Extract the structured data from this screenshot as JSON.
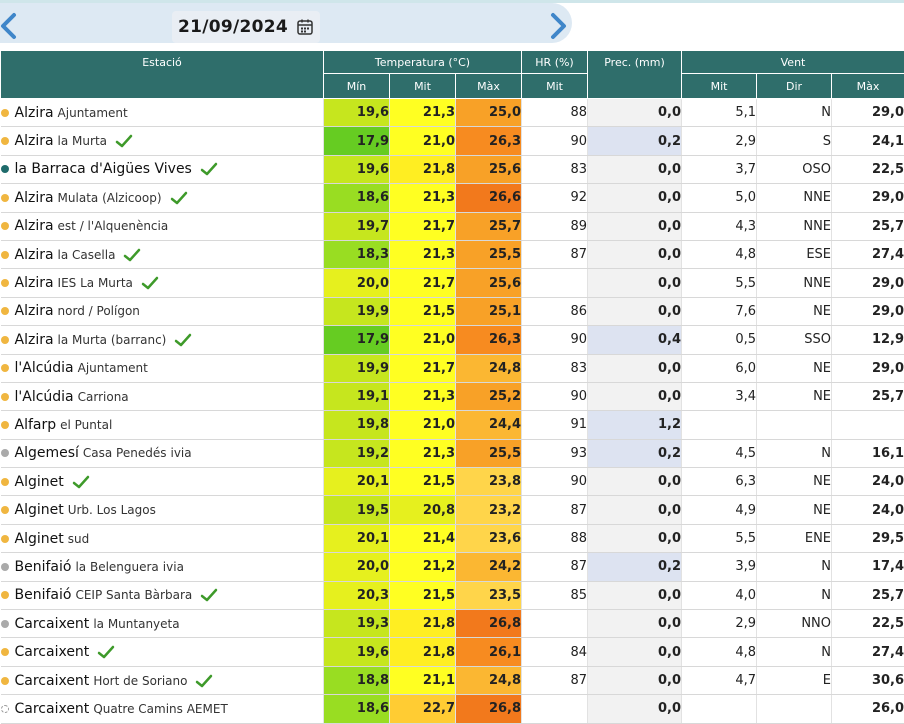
{
  "date": {
    "value": "21/09/2024",
    "prev_icon": "chevron-left-icon",
    "next_icon": "chevron-right-icon",
    "calendar_icon": "calendar-icon"
  },
  "colors": {
    "header_bg": "#2f6e6b",
    "temp_scale": {
      "17.9": "#66cc22",
      "18": "#99dd22",
      "19": "#c6e61e",
      "20": "#e6f01e",
      "21": "#ffff22",
      "21.8": "#ffee22",
      "22.7": "#ffcc33",
      "23": "#ffd54a",
      "24": "#fbb732",
      "25": "#f8a127",
      "26": "#f78b20",
      "26.5": "#f2791c"
    },
    "dot_orange": "#f0b640",
    "dot_teal": "#1f6b6b",
    "dot_gray": "#aaaaaa",
    "check_green": "#3e9a2a",
    "precip_highlight": "#dde3f1"
  },
  "table": {
    "headers": {
      "station": "Estació",
      "temperature": "Temperatura (°C)",
      "hr": "HR (%)",
      "prec": "Prec. (mm)",
      "wind": "Vent",
      "min": "Mín",
      "mit": "Mit",
      "max": "Màx",
      "hr_mit": "Mit",
      "wind_mit": "Mit",
      "wind_dir": "Dir",
      "wind_max": "Màx"
    },
    "rows": [
      {
        "name": "Alzira",
        "sub": "Ajuntament",
        "extra": "",
        "dot": "orange",
        "check": false,
        "min": "19,6",
        "mit": "21,3",
        "max": "25,0",
        "hr": "88",
        "prec": "0,0",
        "wmit": "5,1",
        "wdir": "N",
        "wmax": "29,0"
      },
      {
        "name": "Alzira",
        "sub": "la Murta",
        "extra": "",
        "dot": "orange",
        "check": true,
        "min": "17,9",
        "mit": "21,0",
        "max": "26,3",
        "hr": "90",
        "prec": "0,2",
        "wmit": "2,9",
        "wdir": "S",
        "wmax": "24,1"
      },
      {
        "name": "la Barraca d'Aigües Vives",
        "sub": "",
        "extra": "",
        "dot": "teal",
        "check": true,
        "min": "19,6",
        "mit": "21,8",
        "max": "25,6",
        "hr": "83",
        "prec": "0,0",
        "wmit": "3,7",
        "wdir": "OSO",
        "wmax": "22,5"
      },
      {
        "name": "Alzira",
        "sub": "Mulata (Alzicoop)",
        "extra": "",
        "dot": "orange",
        "check": true,
        "min": "18,6",
        "mit": "21,3",
        "max": "26,6",
        "hr": "92",
        "prec": "0,0",
        "wmit": "5,0",
        "wdir": "NNE",
        "wmax": "29,0"
      },
      {
        "name": "Alzira",
        "sub": "est / l'Alquenència",
        "extra": "",
        "dot": "orange",
        "check": false,
        "min": "19,7",
        "mit": "21,7",
        "max": "25,7",
        "hr": "89",
        "prec": "0,0",
        "wmit": "4,3",
        "wdir": "NNE",
        "wmax": "25,7"
      },
      {
        "name": "Alzira",
        "sub": "la Casella",
        "extra": "",
        "dot": "orange",
        "check": true,
        "min": "18,3",
        "mit": "21,3",
        "max": "25,5",
        "hr": "87",
        "prec": "0,0",
        "wmit": "4,8",
        "wdir": "ESE",
        "wmax": "27,4"
      },
      {
        "name": "Alzira",
        "sub": "IES La Murta",
        "extra": "",
        "dot": "orange",
        "check": true,
        "min": "20,0",
        "mit": "21,7",
        "max": "25,6",
        "hr": "",
        "prec": "0,0",
        "wmit": "5,5",
        "wdir": "NNE",
        "wmax": "29,0"
      },
      {
        "name": "Alzira",
        "sub": "nord / Polígon",
        "extra": "",
        "dot": "orange",
        "check": false,
        "min": "19,9",
        "mit": "21,5",
        "max": "25,1",
        "hr": "86",
        "prec": "0,0",
        "wmit": "7,6",
        "wdir": "NE",
        "wmax": "29,0"
      },
      {
        "name": "Alzira",
        "sub": "la Murta (barranc)",
        "extra": "",
        "dot": "orange",
        "check": true,
        "min": "17,9",
        "mit": "21,0",
        "max": "26,3",
        "hr": "90",
        "prec": "0,4",
        "wmit": "0,5",
        "wdir": "SSO",
        "wmax": "12,9"
      },
      {
        "name": "l'Alcúdia",
        "sub": "Ajuntament",
        "extra": "",
        "dot": "orange",
        "check": false,
        "min": "19,9",
        "mit": "21,7",
        "max": "24,8",
        "hr": "83",
        "prec": "0,0",
        "wmit": "6,0",
        "wdir": "NE",
        "wmax": "29,0"
      },
      {
        "name": "l'Alcúdia",
        "sub": "Carriona",
        "extra": "",
        "dot": "orange",
        "check": false,
        "min": "19,1",
        "mit": "21,3",
        "max": "25,2",
        "hr": "90",
        "prec": "0,0",
        "wmit": "3,4",
        "wdir": "NE",
        "wmax": "25,7"
      },
      {
        "name": "Alfarp",
        "sub": "el Puntal",
        "extra": "",
        "dot": "orange",
        "check": false,
        "min": "19,8",
        "mit": "21,0",
        "max": "24,4",
        "hr": "91",
        "prec": "1,2",
        "wmit": "",
        "wdir": "",
        "wmax": ""
      },
      {
        "name": "Algemesí",
        "sub": "Casa Penedés",
        "extra": "ivia",
        "dot": "gray",
        "check": false,
        "min": "19,2",
        "mit": "21,3",
        "max": "25,5",
        "hr": "93",
        "prec": "0,2",
        "wmit": "4,5",
        "wdir": "N",
        "wmax": "16,1"
      },
      {
        "name": "Alginet",
        "sub": "",
        "extra": "",
        "dot": "orange",
        "check": true,
        "min": "20,1",
        "mit": "21,5",
        "max": "23,8",
        "hr": "90",
        "prec": "0,0",
        "wmit": "6,3",
        "wdir": "NE",
        "wmax": "24,0"
      },
      {
        "name": "Alginet",
        "sub": "Urb. Los Lagos",
        "extra": "",
        "dot": "orange",
        "check": false,
        "min": "19,5",
        "mit": "20,8",
        "max": "23,2",
        "hr": "87",
        "prec": "0,0",
        "wmit": "4,9",
        "wdir": "NE",
        "wmax": "24,0"
      },
      {
        "name": "Alginet",
        "sub": "sud",
        "extra": "",
        "dot": "orange",
        "check": false,
        "min": "20,1",
        "mit": "21,4",
        "max": "23,6",
        "hr": "88",
        "prec": "0,0",
        "wmit": "5,5",
        "wdir": "ENE",
        "wmax": "29,5"
      },
      {
        "name": "Benifaió",
        "sub": "la Belenguera",
        "extra": "ivia",
        "dot": "gray",
        "check": false,
        "min": "20,0",
        "mit": "21,2",
        "max": "24,2",
        "hr": "87",
        "prec": "0,2",
        "wmit": "3,9",
        "wdir": "N",
        "wmax": "17,4"
      },
      {
        "name": "Benifaió",
        "sub": "CEIP Santa Bàrbara",
        "extra": "",
        "dot": "orange",
        "check": true,
        "min": "20,3",
        "mit": "21,5",
        "max": "23,5",
        "hr": "85",
        "prec": "0,0",
        "wmit": "4,0",
        "wdir": "N",
        "wmax": "25,7"
      },
      {
        "name": "Carcaixent",
        "sub": "la Muntanyeta",
        "extra": "",
        "dot": "gray",
        "check": false,
        "min": "19,3",
        "mit": "21,8",
        "max": "26,8",
        "hr": "",
        "prec": "0,0",
        "wmit": "2,9",
        "wdir": "NNO",
        "wmax": "22,5"
      },
      {
        "name": "Carcaixent",
        "sub": "",
        "extra": "",
        "dot": "orange",
        "check": true,
        "min": "19,6",
        "mit": "21,8",
        "max": "26,1",
        "hr": "84",
        "prec": "0,0",
        "wmit": "4,8",
        "wdir": "N",
        "wmax": "27,4"
      },
      {
        "name": "Carcaixent",
        "sub": "Hort de Soriano",
        "extra": "",
        "dot": "orange",
        "check": true,
        "min": "18,8",
        "mit": "21,1",
        "max": "24,8",
        "hr": "87",
        "prec": "0,0",
        "wmit": "4,7",
        "wdir": "E",
        "wmax": "30,6"
      },
      {
        "name": "Carcaixent",
        "sub": "Quatre Camins AEMET",
        "extra": "",
        "dot": "hollow",
        "check": false,
        "min": "18,6",
        "mit": "22,7",
        "max": "26,8",
        "hr": "",
        "prec": "0,0",
        "wmit": "",
        "wdir": "",
        "wmax": "26,0"
      }
    ]
  }
}
